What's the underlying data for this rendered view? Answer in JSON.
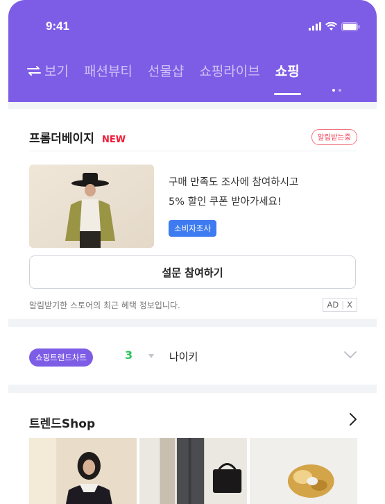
{
  "status_bar": {
    "time": "9:41"
  },
  "tabs": [
    {
      "label": "보기"
    },
    {
      "label": "패션뷰티"
    },
    {
      "label": "선물샵"
    },
    {
      "label": "쇼핑라이브"
    },
    {
      "label": "쇼핑",
      "active": true
    }
  ],
  "promo_card": {
    "title": "프롬더베이지",
    "badge": "NEW",
    "alert_label": "알림받는중",
    "message_line1": "구매 만족도 조사에 참여하시고",
    "message_line2": "5% 할인 쿠폰 받아가세요!",
    "tag": "소비자조사",
    "button_label": "설문 참여하기",
    "notice": "알림받기한 스토어의 최근 혜택 정보입니다.",
    "ad_label": "AD",
    "ad_close": "X"
  },
  "trend_chart": {
    "chip_label": "쇼핑트렌드차트",
    "rank": "3",
    "keyword": "나이키"
  },
  "trend_shop": {
    "title": "트렌드Shop"
  },
  "colors": {
    "brand": "#7e5de6",
    "new_badge": "#f01a37",
    "tag_blue": "#3e7bf0",
    "rank_up": "#2ec25b"
  }
}
